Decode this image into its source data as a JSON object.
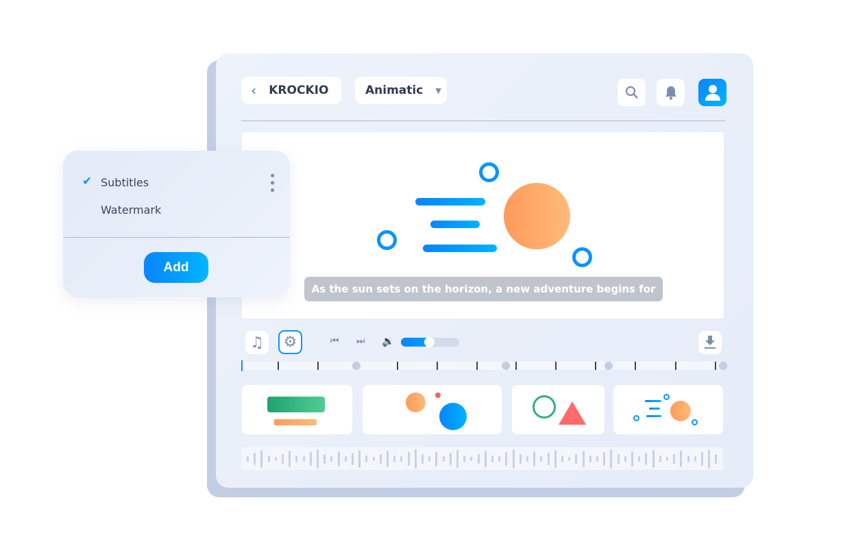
{
  "header": {
    "back_label": "KROCKIO",
    "mode_select": "Animatic",
    "icons": [
      "search-icon",
      "bell-icon",
      "user-icon"
    ]
  },
  "preview": {
    "subtitle": "As the sun sets on the horizon, a new adventure begins for"
  },
  "controls": {
    "icons": [
      "music-icon",
      "gear-icon",
      "skip-back-icon",
      "skip-forward-icon",
      "volume-icon",
      "download-icon"
    ],
    "volume_percent": 50
  },
  "popup": {
    "items": [
      {
        "label": "Subtitles",
        "checked": true
      },
      {
        "label": "Watermark",
        "checked": false
      }
    ],
    "add_label": "Add"
  },
  "colors": {
    "accent": "#0a84ff",
    "sun": "#ff9a5c",
    "panel": "#e8eef9"
  }
}
